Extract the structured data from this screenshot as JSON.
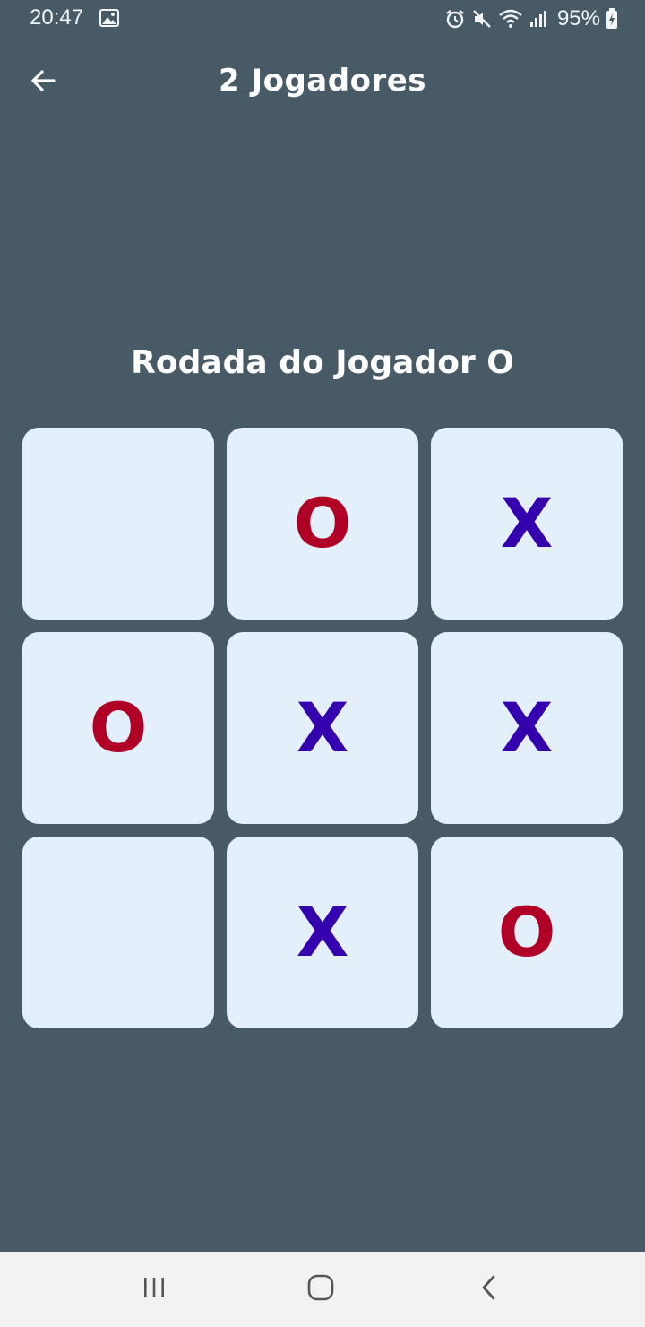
{
  "status_bar": {
    "time": "20:47",
    "battery": "95%",
    "icons": [
      "gallery-icon",
      "alarm-icon",
      "mute-icon",
      "wifi-icon",
      "signal-icon",
      "battery-charging-icon"
    ]
  },
  "app_bar": {
    "title": "2 Jogadores",
    "back_icon": "arrow-back-icon"
  },
  "game": {
    "turn_label": "Rodada do Jogador O",
    "board": [
      [
        "",
        "O",
        "X"
      ],
      [
        "O",
        "X",
        "X"
      ],
      [
        "",
        "X",
        "O"
      ]
    ],
    "colors": {
      "x": "#3500ad",
      "o": "#b00025",
      "cell": "#e3f0fb",
      "background": "#485a66"
    }
  },
  "nav_bar": {
    "icons": [
      "recent-apps-icon",
      "home-icon",
      "back-icon"
    ]
  }
}
